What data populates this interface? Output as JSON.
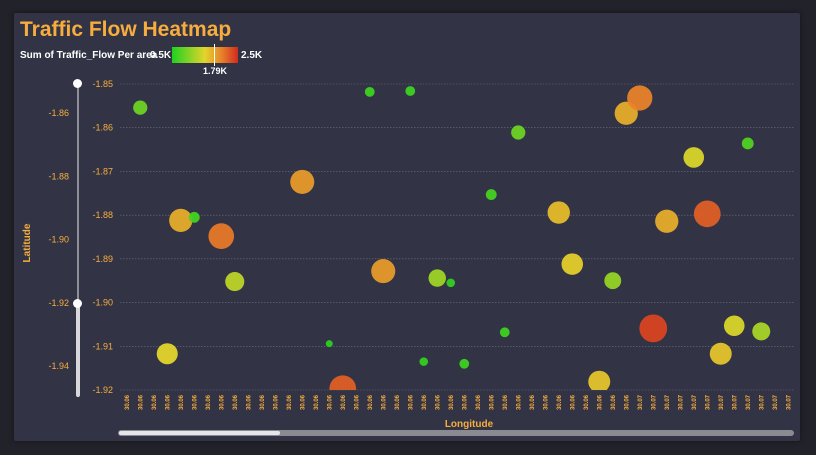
{
  "title": "Traffic Flow Heatmap",
  "legend": {
    "label": "Sum of Traffic_Flow Per area",
    "min_label": "0.5K",
    "max_label": "2.5K",
    "marker_label": "1.79K",
    "min_value": 500,
    "max_value": 2500,
    "marker_value": 1790
  },
  "colors": {
    "accent": "#f6ad3e",
    "background": "#22232a",
    "card": "#323445",
    "low": "#1fd11f",
    "mid": "#e3d52b",
    "high": "#d12a1f"
  },
  "slider": {
    "ticks": [
      "-1.86",
      "-1.88",
      "-1.90",
      "-1.92",
      "-1.94"
    ],
    "selected_from": -1.92,
    "selected_to": -1.946
  },
  "chart_data": {
    "type": "scatter",
    "title": "",
    "xlabel": "Longitude",
    "ylabel": "Latitude",
    "ylim": [
      -1.92,
      -1.85
    ],
    "y_ticks": [
      "-1.85",
      "-1.86",
      "-1.87",
      "-1.88",
      "-1.89",
      "-1.90",
      "-1.91",
      "-1.92"
    ],
    "x_ticks": [
      "30.06",
      "30.06",
      "30.06",
      "30.06",
      "30.06",
      "30.06",
      "30.06",
      "30.06",
      "30.06",
      "30.06",
      "30.06",
      "30.06",
      "30.06",
      "30.06",
      "30.06",
      "30.06",
      "30.06",
      "30.06",
      "30.06",
      "30.06",
      "30.06",
      "30.06",
      "30.06",
      "30.06",
      "30.06",
      "30.06",
      "30.06",
      "30.06",
      "30.06",
      "30.06",
      "30.06",
      "30.06",
      "30.06",
      "30.06",
      "30.06",
      "30.06",
      "30.06",
      "30.06",
      "30.07",
      "30.07",
      "30.07",
      "30.07",
      "30.07",
      "30.07",
      "30.07",
      "30.07",
      "30.07",
      "30.07",
      "30.07",
      "30.07"
    ],
    "grid": true,
    "size_encoding": "Sum of Traffic_Flow Per area",
    "points": [
      {
        "x": 1,
        "y": -1.8554,
        "v": 900
      },
      {
        "x": 4,
        "y": -1.8812,
        "v": 1750
      },
      {
        "x": 5,
        "y": -1.8805,
        "v": 700
      },
      {
        "x": 7,
        "y": -1.8848,
        "v": 2050
      },
      {
        "x": 3,
        "y": -1.9117,
        "v": 1500
      },
      {
        "x": 8,
        "y": -1.8952,
        "v": 1300
      },
      {
        "x": 13,
        "y": -1.8724,
        "v": 1850
      },
      {
        "x": 15,
        "y": -1.9094,
        "v": 550
      },
      {
        "x": 16,
        "y": -1.9197,
        "v": 2200
      },
      {
        "x": 18,
        "y": -1.8518,
        "v": 650
      },
      {
        "x": 19,
        "y": -1.8928,
        "v": 1850
      },
      {
        "x": 21,
        "y": -1.8516,
        "v": 650
      },
      {
        "x": 22,
        "y": -1.9135,
        "v": 600
      },
      {
        "x": 23,
        "y": -1.8944,
        "v": 1150
      },
      {
        "x": 24,
        "y": -1.8955,
        "v": 600
      },
      {
        "x": 25,
        "y": -1.914,
        "v": 650
      },
      {
        "x": 27,
        "y": -1.8753,
        "v": 700
      },
      {
        "x": 28,
        "y": -1.9068,
        "v": 650
      },
      {
        "x": 29,
        "y": -1.8611,
        "v": 900
      },
      {
        "x": 32,
        "y": -1.8794,
        "v": 1650
      },
      {
        "x": 33,
        "y": -1.8912,
        "v": 1550
      },
      {
        "x": 35,
        "y": -1.9181,
        "v": 1600
      },
      {
        "x": 36,
        "y": -1.895,
        "v": 1100
      },
      {
        "x": 37,
        "y": -1.8567,
        "v": 1750
      },
      {
        "x": 38,
        "y": -1.8532,
        "v": 2000
      },
      {
        "x": 39,
        "y": -1.9059,
        "v": 2350
      },
      {
        "x": 40,
        "y": -1.8814,
        "v": 1750
      },
      {
        "x": 42,
        "y": -1.8668,
        "v": 1450
      },
      {
        "x": 43,
        "y": -1.8797,
        "v": 2200
      },
      {
        "x": 44,
        "y": -1.9117,
        "v": 1600
      },
      {
        "x": 45,
        "y": -1.9053,
        "v": 1450
      },
      {
        "x": 46,
        "y": -1.8636,
        "v": 750
      },
      {
        "x": 47,
        "y": -1.9066,
        "v": 1200
      }
    ]
  }
}
